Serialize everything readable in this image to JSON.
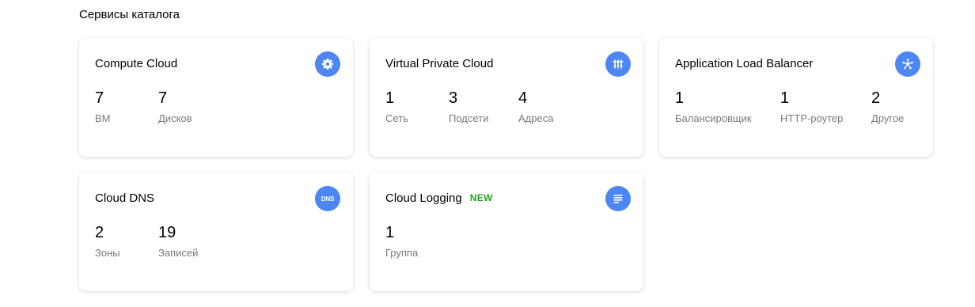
{
  "section": {
    "title": "Сервисы каталога"
  },
  "cards": [
    {
      "title": "Compute Cloud",
      "icon": "compute-gear-icon",
      "stats": [
        {
          "value": "7",
          "label": "ВМ"
        },
        {
          "value": "7",
          "label": "Дисков"
        }
      ]
    },
    {
      "title": "Virtual Private Cloud",
      "icon": "network-icon",
      "stats": [
        {
          "value": "1",
          "label": "Сеть"
        },
        {
          "value": "3",
          "label": "Подсети"
        },
        {
          "value": "4",
          "label": "Адреса"
        }
      ]
    },
    {
      "title": "Application Load Balancer",
      "icon": "load-balancer-icon",
      "stats": [
        {
          "value": "1",
          "label": "Балансировщик"
        },
        {
          "value": "1",
          "label": "HTTP-роутер"
        },
        {
          "value": "2",
          "label": "Другое"
        }
      ]
    },
    {
      "title": "Cloud DNS",
      "icon": "dns-icon",
      "icon_text": "DNS",
      "stats": [
        {
          "value": "2",
          "label": "Зоны"
        },
        {
          "value": "19",
          "label": "Записей"
        }
      ]
    },
    {
      "title": "Cloud Logging",
      "badge": "NEW",
      "icon": "logging-list-icon",
      "stats": [
        {
          "value": "1",
          "label": "Группа"
        }
      ]
    }
  ],
  "colors": {
    "icon_background": "#4d86f5",
    "badge_new": "#24a31c",
    "stat_label": "#7a7a7a"
  }
}
